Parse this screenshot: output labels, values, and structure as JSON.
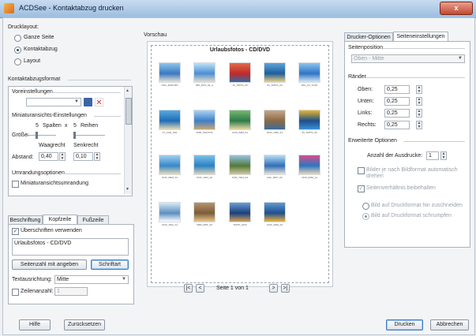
{
  "window": {
    "title": "ACDSee - Kontaktabzug drucken",
    "close_label": "x"
  },
  "layout_group": {
    "label": "Drucklayout:",
    "options": [
      {
        "label": "Ganze Seite",
        "selected": false
      },
      {
        "label": "Kontaktabzug",
        "selected": true
      },
      {
        "label": "Layout",
        "selected": false
      }
    ]
  },
  "format_group": {
    "label": "Kontaktabzugsformat",
    "presets_label": "Voreinstellungen",
    "thumbs_label": "Miniaturansichts-Einstellungen",
    "size_label": "Größe:",
    "columns_value": "5",
    "columns_label": "Spalten",
    "times": "x",
    "rows_value": "5",
    "rows_label": "Reihen",
    "horizontal_label": "Waagrecht",
    "vertical_label": "Senkrecht",
    "spacing_label": "Abstand:",
    "horizontal_value": "0,40",
    "vertical_value": "0,10",
    "border_options_label": "Umrandungsoptionen",
    "border_checkbox_label": "Miniaturansichtsumrandung"
  },
  "header_tabs": {
    "tabs": [
      {
        "label": "Beschriftung",
        "active": false
      },
      {
        "label": "Kopfzeile",
        "active": true
      },
      {
        "label": "Fußzeile",
        "active": false
      }
    ],
    "use_headers_label": "Überschriften verwenden",
    "header_text": "Urlaubsfotos - CD/DVD",
    "page_number_button": "Seitenzahl mit angeben",
    "font_button": "Schriftart",
    "text_align_label": "Textausrichtung:",
    "text_align_value": "Mitte",
    "line_count_label": "Zeilenanzahl:",
    "line_count_value": "1"
  },
  "preview": {
    "label": "Vorschau",
    "page_title": "Urlaubsfotos - CD/DVD",
    "page_text": "Seite 1 von 1",
    "nav": {
      "first": "|<",
      "prev": "<",
      "next": ">",
      "last": ">|"
    },
    "thumbnails": [
      {
        "caption": "7304_30207007",
        "colors": [
          "#3a78c2",
          "#8ec6ea",
          "#e9e4d2"
        ]
      },
      {
        "caption": "086_0070_02_A",
        "colors": [
          "#4b8fd6",
          "#bfe3f6",
          "#eadfc7"
        ]
      },
      {
        "caption": "10_TAPTA_00",
        "colors": [
          "#c02a2a",
          "#e06a4a",
          "#2f6aa8"
        ]
      },
      {
        "caption": "24_TAPTA_00",
        "colors": [
          "#1d5e9e",
          "#5fa4d8",
          "#f0d27a"
        ]
      },
      {
        "caption": "PAC_04_TCAP",
        "colors": [
          "#2f75c4",
          "#8cc3ef",
          "#d6e8f3"
        ]
      },
      {
        "caption": "07_1102_P02",
        "colors": [
          "#1f6db5",
          "#5aa9df",
          "#e7d9b5"
        ]
      },
      {
        "caption": "0000_PHOTOS",
        "colors": [
          "#3f7ec8",
          "#a7d4f2",
          "#c9a775"
        ]
      },
      {
        "caption": "OCR_0064_01",
        "colors": [
          "#2e7a4a",
          "#79b86e",
          "#e6d6a3"
        ]
      },
      {
        "caption": "OCR_1300_A1",
        "colors": [
          "#8a6a45",
          "#c5a98a",
          "#3d6b9b"
        ]
      },
      {
        "caption": "00_TAPTA_00",
        "colors": [
          "#1d4f8c",
          "#e6b62c",
          "#3a8fd6"
        ]
      },
      {
        "caption": "OCR_0904_F1",
        "colors": [
          "#3887c9",
          "#9fd0ef",
          "#eadbb2"
        ]
      },
      {
        "caption": "OCR_1031_F2",
        "colors": [
          "#2a82c4",
          "#7cc0e8",
          "#e2d6b8"
        ]
      },
      {
        "caption": "OCR_7024_D1",
        "colors": [
          "#4f7a3a",
          "#9bc2e0",
          "#d8c89a"
        ]
      },
      {
        "caption": "EAL_0007_00",
        "colors": [
          "#2f6fb8",
          "#b4dcf4",
          "#efe6d2"
        ]
      },
      {
        "caption": "OCR_0064_11",
        "colors": [
          "#2b77c2",
          "#d94d8c",
          "#efd6b5"
        ]
      },
      {
        "caption": "OCR_1102_A1",
        "colors": [
          "#5c8fc0",
          "#d9e9f4",
          "#ffffff"
        ]
      },
      {
        "caption": "5000_MPF_00",
        "colors": [
          "#7a5c3a",
          "#b99468",
          "#e8c98c"
        ]
      },
      {
        "caption": "TAPTA_0072",
        "colors": [
          "#1b3f7a",
          "#6a9ed6",
          "#d2a25c"
        ]
      },
      {
        "caption": "OCR_4000_02",
        "colors": [
          "#1e4f8f",
          "#5f9ad1",
          "#f0b43c"
        ]
      }
    ]
  },
  "right_tabs": {
    "tabs": [
      {
        "label": "Drucker-Optionen",
        "active": false
      },
      {
        "label": "Seiteneinstellungen",
        "active": true
      }
    ],
    "page_position_label": "Seitenposition",
    "page_position_value": "Oben - Mitte",
    "margins_label": "Ränder",
    "margins": [
      {
        "label": "Oben:",
        "value": "0,25"
      },
      {
        "label": "Unten:",
        "value": "0,25"
      },
      {
        "label": "Links:",
        "value": "0,25"
      },
      {
        "label": "Rechts:",
        "value": "0,25"
      }
    ],
    "advanced_label": "Erweiterte Optionen",
    "copies_label": "Anzahl der Ausdrucke:",
    "copies_value": "1",
    "auto_rotate_label": "Bilder je nach Bildformat automatisch drehen",
    "keep_ratio_label": "Seitenverhältnis beibehalten",
    "crop_label": "Bild auf Druckformat hin zuschneiden",
    "shrink_label": "Bild auf Druckformat schrumpfen"
  },
  "footer": {
    "help_button": "Hilfe",
    "reset_button": "Zurücksetzen",
    "print_button": "Drucken",
    "cancel_button": "Abbrechen"
  }
}
